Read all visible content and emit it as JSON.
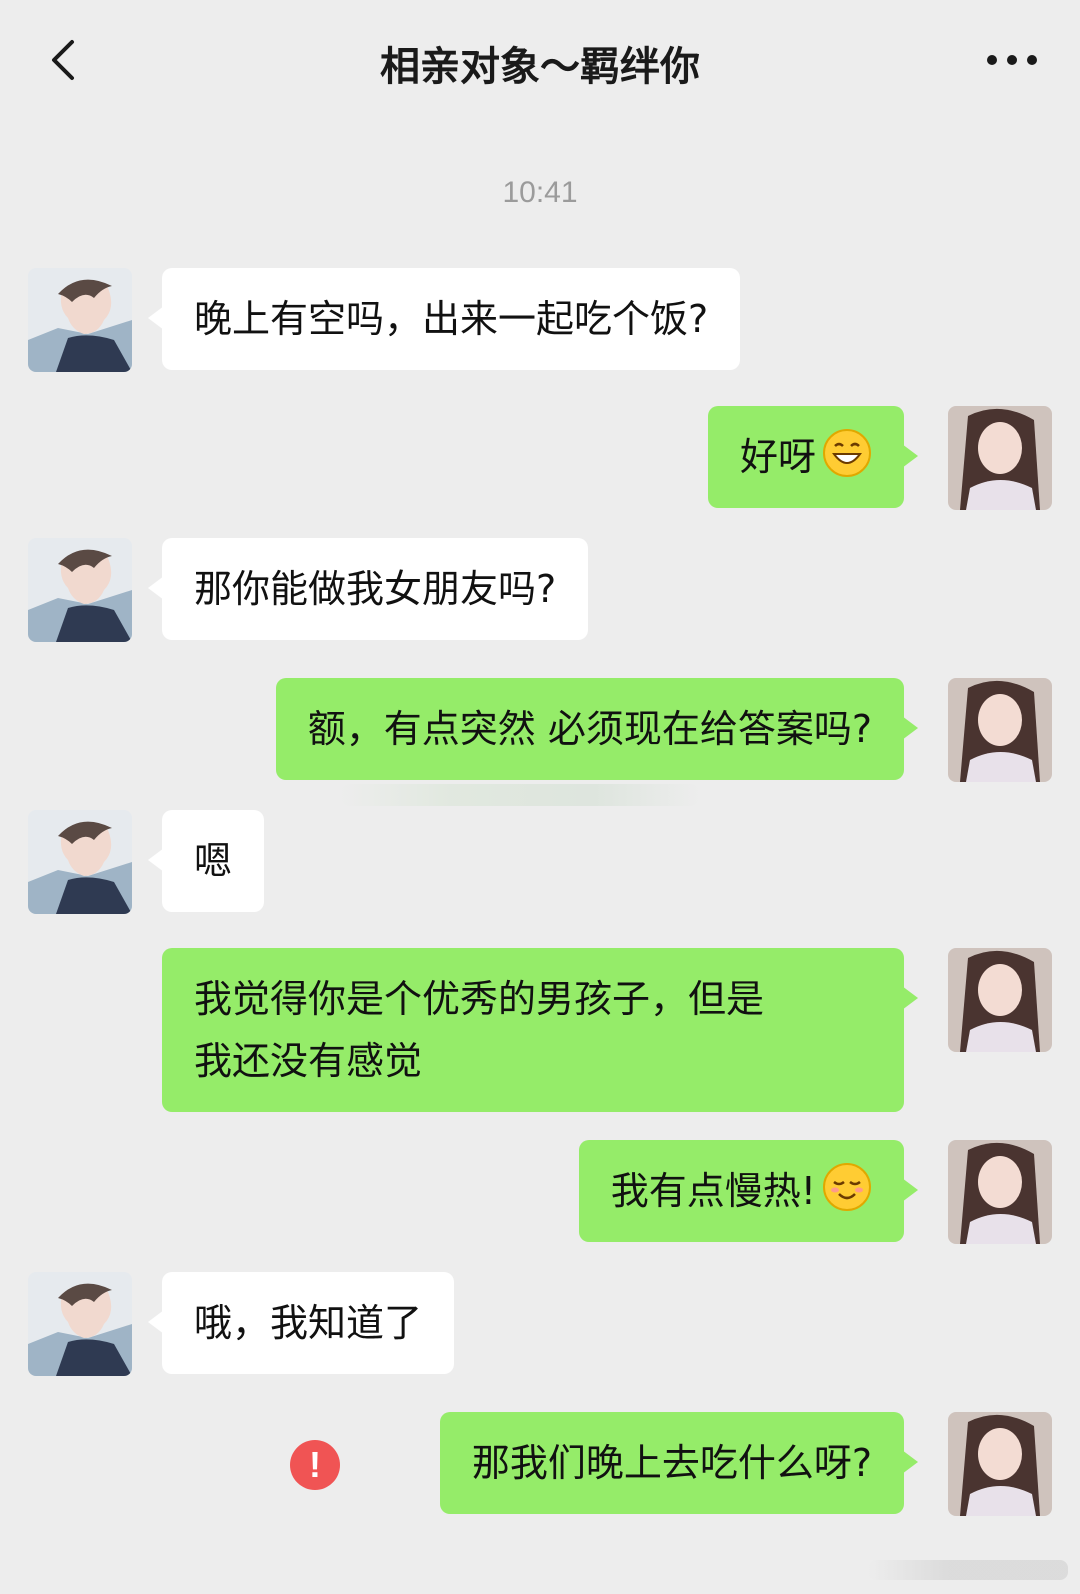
{
  "header": {
    "title": "相亲对象～羁绊你",
    "back_icon": "chevron-left-icon",
    "more_icon": "more-dots-icon"
  },
  "timestamp": "10:41",
  "colors": {
    "background": "#ededed",
    "incoming_bubble": "#ffffff",
    "outgoing_bubble": "#95ec69",
    "error": "#f05454"
  },
  "messages": [
    {
      "side": "left",
      "text": "晚上有空吗，出来一起吃个饭?"
    },
    {
      "side": "right",
      "text": "好呀",
      "emoji": "grinning-face-emoji"
    },
    {
      "side": "left",
      "text": "那你能做我女朋友吗?"
    },
    {
      "side": "right",
      "text": "额，有点突然 必须现在给答案吗?"
    },
    {
      "side": "left",
      "text": "嗯"
    },
    {
      "side": "right",
      "line1": "我觉得你是个优秀的男孩子，但是",
      "line2": "我还没有感觉"
    },
    {
      "side": "right",
      "text": "我有点慢热!",
      "emoji": "shy-smile-emoji"
    },
    {
      "side": "left",
      "text": "哦，我知道了"
    },
    {
      "side": "right",
      "text": "那我们晚上去吃什么呀?",
      "status": "send-failed",
      "status_icon": "error-icon",
      "status_glyph": "!"
    }
  ]
}
